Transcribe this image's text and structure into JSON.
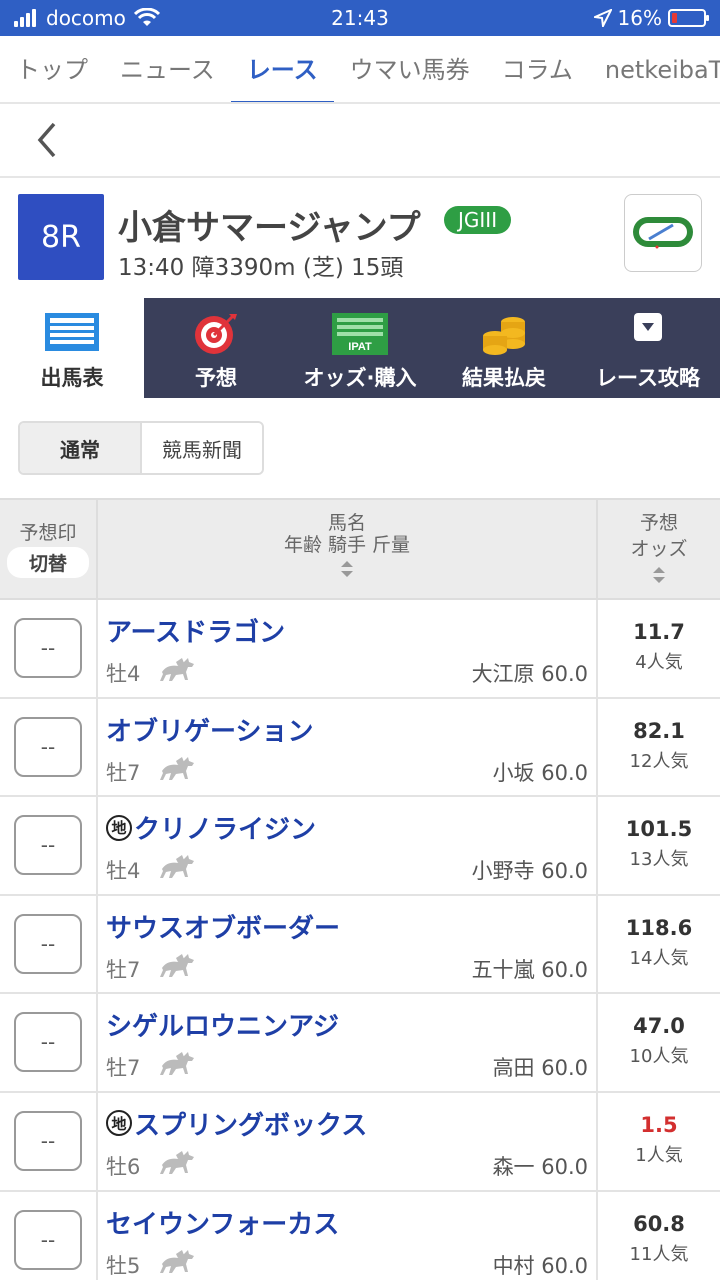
{
  "status": {
    "carrier": "docomo",
    "time": "21:43",
    "battery": "16%",
    "battery_level": 0.16
  },
  "topnav": [
    {
      "label": "トップ",
      "active": false
    },
    {
      "label": "ニュース",
      "active": false
    },
    {
      "label": "レース",
      "active": true
    },
    {
      "label": "ウマい馬券",
      "active": false
    },
    {
      "label": "コラム",
      "active": false
    },
    {
      "label": "netkeibaT",
      "active": false
    }
  ],
  "race": {
    "number": "8R",
    "name": "小倉サマージャンプ",
    "grade": "JGIII",
    "info": "13:40 障3390m (芝) 15頭",
    "course_icon": "course-map-icon"
  },
  "menu": [
    {
      "label": "出馬表",
      "icon": "entry-table-icon",
      "active": true
    },
    {
      "label": "予想",
      "icon": "target-icon",
      "active": false
    },
    {
      "label": "オッズ·購入",
      "icon": "ipat-icon",
      "active": false
    },
    {
      "label": "結果払戻",
      "icon": "coins-icon",
      "active": false
    },
    {
      "label": "レース攻略",
      "icon": "dropdown-icon",
      "active": false
    }
  ],
  "toggle": {
    "on": "通常",
    "off": "競馬新聞"
  },
  "table": {
    "col1_title": "予想印",
    "col1_button": "切替",
    "col2_line1": "馬名",
    "col2_line2": "年齢 騎手 斤量",
    "col3_line1": "予想",
    "col3_line2": "オッズ"
  },
  "horses": [
    {
      "mark": "--",
      "name": "アースドラゴン",
      "chiho": false,
      "sex_age": "牡4",
      "jockey": "大江原 60.0",
      "odds": "11.7",
      "pop": "4人気",
      "fav": false
    },
    {
      "mark": "--",
      "name": "オブリゲーション",
      "chiho": false,
      "sex_age": "牡7",
      "jockey": "小坂 60.0",
      "odds": "82.1",
      "pop": "12人気",
      "fav": false
    },
    {
      "mark": "--",
      "name": "クリノライジン",
      "chiho": true,
      "chiho_label": "地",
      "sex_age": "牡4",
      "jockey": "小野寺 60.0",
      "odds": "101.5",
      "pop": "13人気",
      "fav": false
    },
    {
      "mark": "--",
      "name": "サウスオブボーダー",
      "chiho": false,
      "sex_age": "牡7",
      "jockey": "五十嵐 60.0",
      "odds": "118.6",
      "pop": "14人気",
      "fav": false
    },
    {
      "mark": "--",
      "name": "シゲルロウニンアジ",
      "chiho": false,
      "sex_age": "牡7",
      "jockey": "高田 60.0",
      "odds": "47.0",
      "pop": "10人気",
      "fav": false
    },
    {
      "mark": "--",
      "name": "スプリングボックス",
      "chiho": true,
      "chiho_label": "地",
      "sex_age": "牡6",
      "jockey": "森一 60.0",
      "odds": "1.5",
      "pop": "1人気",
      "fav": true
    },
    {
      "mark": "--",
      "name": "セイウンフォーカス",
      "chiho": false,
      "sex_age": "牡5",
      "jockey": "中村 60.0",
      "odds": "60.8",
      "pop": "11人気",
      "fav": false
    }
  ],
  "colors": {
    "brand": "#2f5fc4",
    "grade": "#2e9e44",
    "menu_bg": "#3a3f5a",
    "horse_name": "#1e3fa6",
    "favorite_odds": "#d32f2f"
  }
}
